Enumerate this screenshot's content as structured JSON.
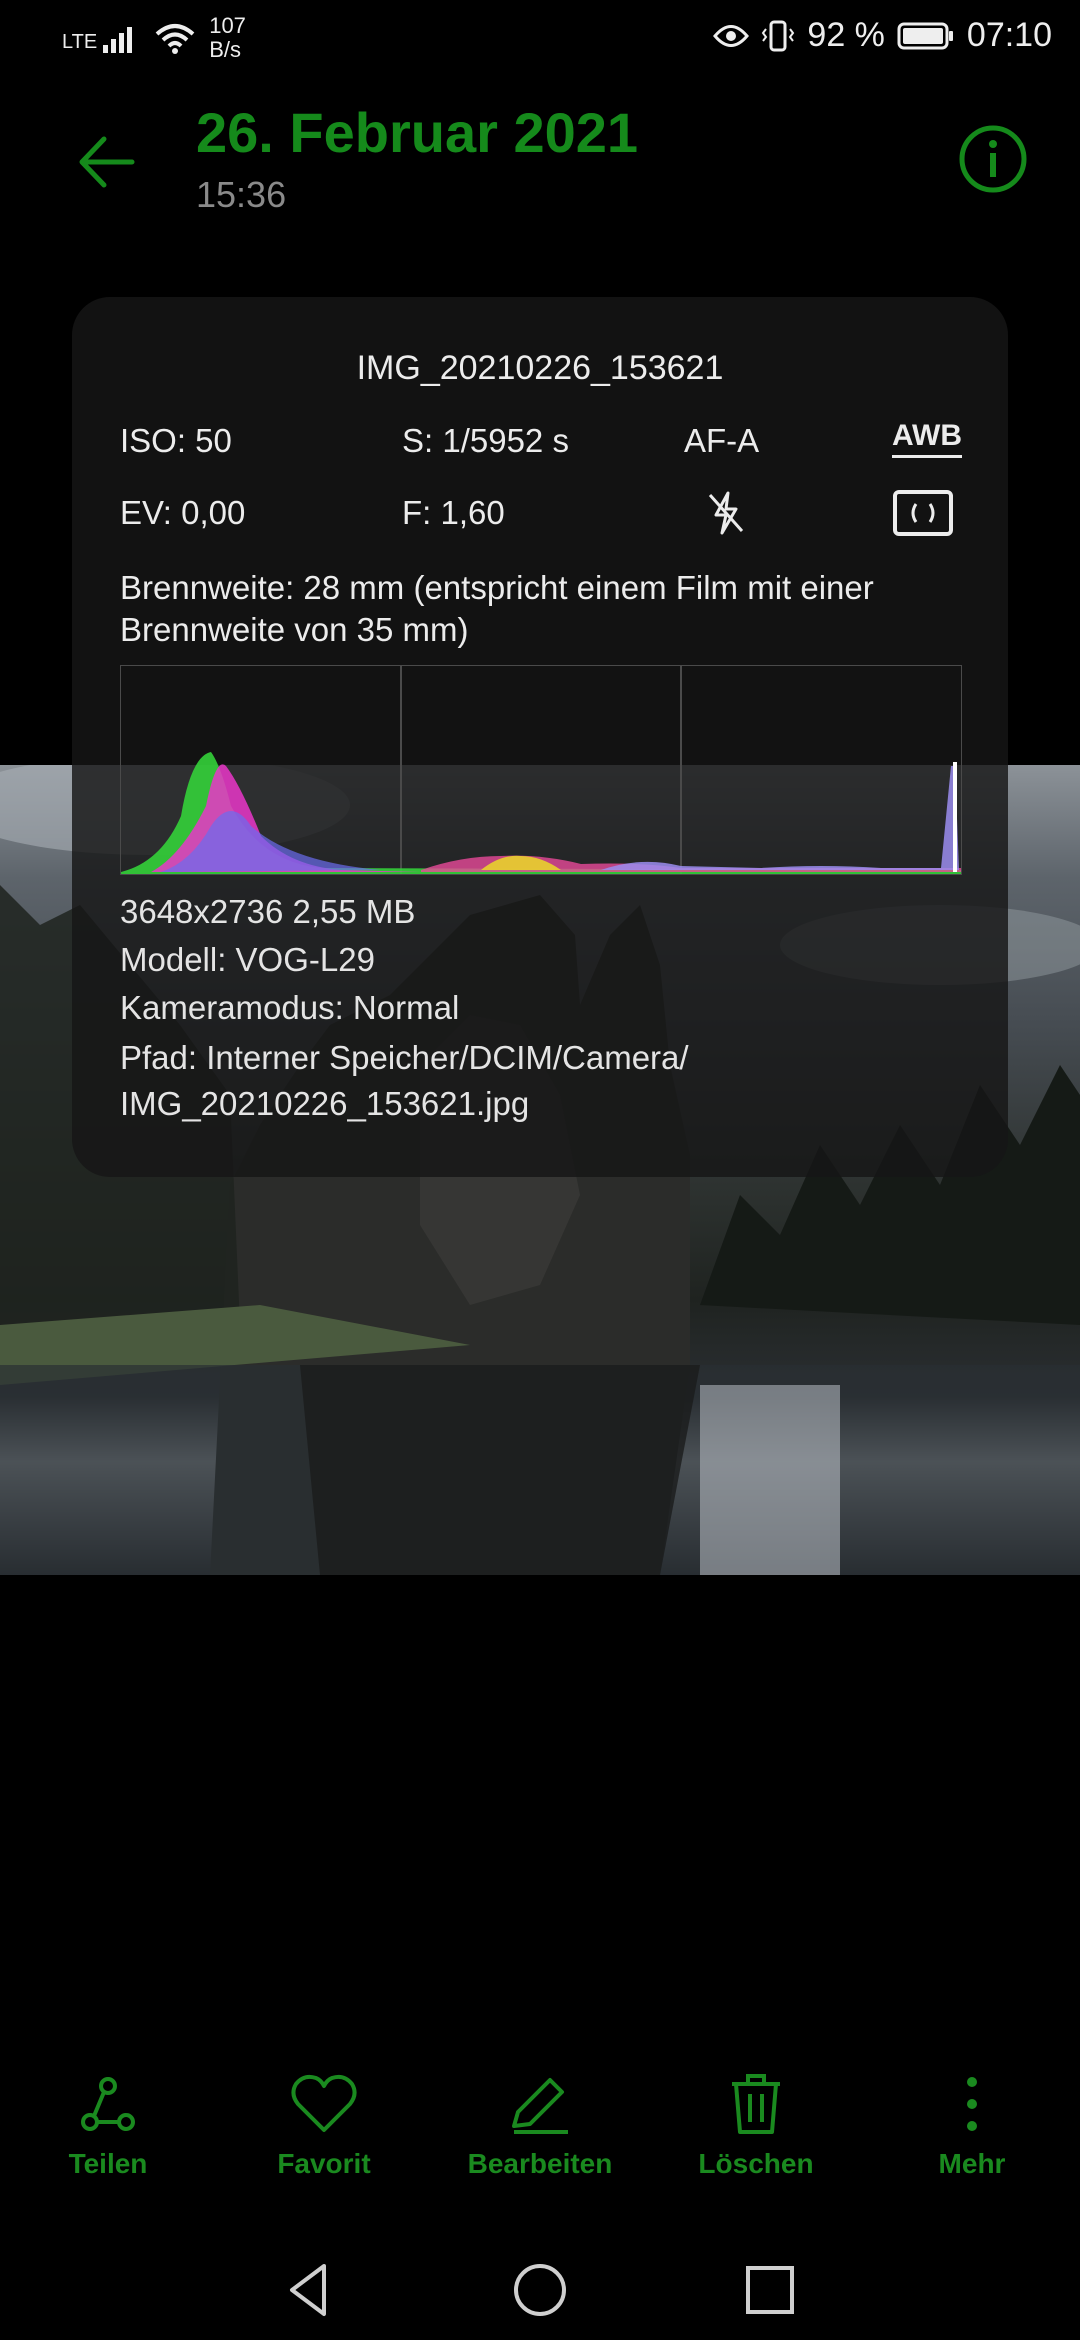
{
  "status_bar": {
    "network": "LTE",
    "speed_value": "107",
    "speed_unit": "B/s",
    "battery": "92 %",
    "time": "07:10"
  },
  "header": {
    "title": "26. Februar 2021",
    "subtitle": "15:36"
  },
  "info": {
    "filename": "IMG_20210226_153621",
    "iso": "ISO: 50",
    "shutter": "S: 1/5952 s",
    "focus_mode": "AF-A",
    "white_balance": "AWB",
    "ev": "EV: 0,00",
    "aperture": "F: 1,60",
    "focal": "Brennweite: 28 mm (entspricht einem Film mit einer Brennweite von 35 mm)",
    "resolution_size": "3648x2736  2,55 MB",
    "model": "Modell:  VOG-L29",
    "camera_mode": "Kameramodus:  Normal",
    "path_line1": "Pfad:  Interner Speicher/DCIM/Camera/",
    "path_line2": "IMG_20210226_153621.jpg"
  },
  "toolbar": {
    "share": "Teilen",
    "favorite": "Favorit",
    "edit": "Bearbeiten",
    "delete": "Löschen",
    "more": "Mehr"
  },
  "icons": {
    "back": "arrow-left-icon",
    "info": "info-icon",
    "flash_off": "flash-off-icon",
    "metering": "metering-icon",
    "share": "share-icon",
    "favorite": "heart-icon",
    "edit": "pencil-icon",
    "delete": "trash-icon",
    "more": "more-vertical-icon"
  },
  "colors": {
    "accent": "#158a1b",
    "background": "#000000"
  }
}
